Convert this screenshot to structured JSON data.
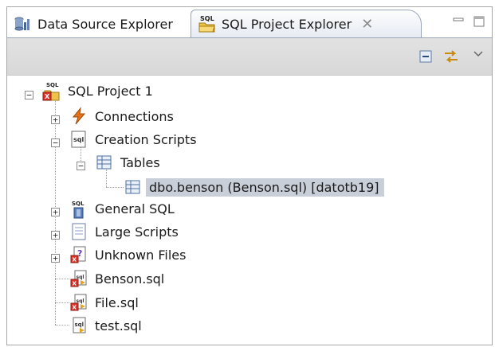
{
  "tabs": [
    {
      "label": "Data Source Explorer",
      "icon": "database-icon",
      "active": false
    },
    {
      "label": "SQL Project Explorer",
      "icon": "sql-folder-icon",
      "active": true
    }
  ],
  "tree": {
    "project": {
      "label": "SQL Project 1",
      "icon": "sql-project-icon"
    },
    "connections": {
      "label": "Connections",
      "icon": "lightning-icon"
    },
    "creation_scripts": {
      "label": "Creation Scripts",
      "icon": "sql-document-icon"
    },
    "tables": {
      "label": "Tables",
      "icon": "table-icon"
    },
    "table_item": {
      "label": "dbo.benson (Benson.sql) [datotb19]",
      "icon": "table-icon",
      "selected": true
    },
    "general_sql": {
      "label": "General SQL",
      "icon": "sql-general-icon"
    },
    "large_scripts": {
      "label": "Large Scripts",
      "icon": "document-icon"
    },
    "unknown_files": {
      "label": "Unknown Files",
      "icon": "unknown-file-icon"
    },
    "benson_sql": {
      "label": "Benson.sql",
      "icon": "sql-file-error-icon"
    },
    "file_sql": {
      "label": "File.sql",
      "icon": "sql-file-error-icon"
    },
    "test_sql": {
      "label": "test.sql",
      "icon": "sql-file-icon"
    }
  },
  "colors": {
    "selection": "#c9cfd9",
    "toolbar": "#dcdcdc",
    "tab_border": "#9aa6b8"
  }
}
